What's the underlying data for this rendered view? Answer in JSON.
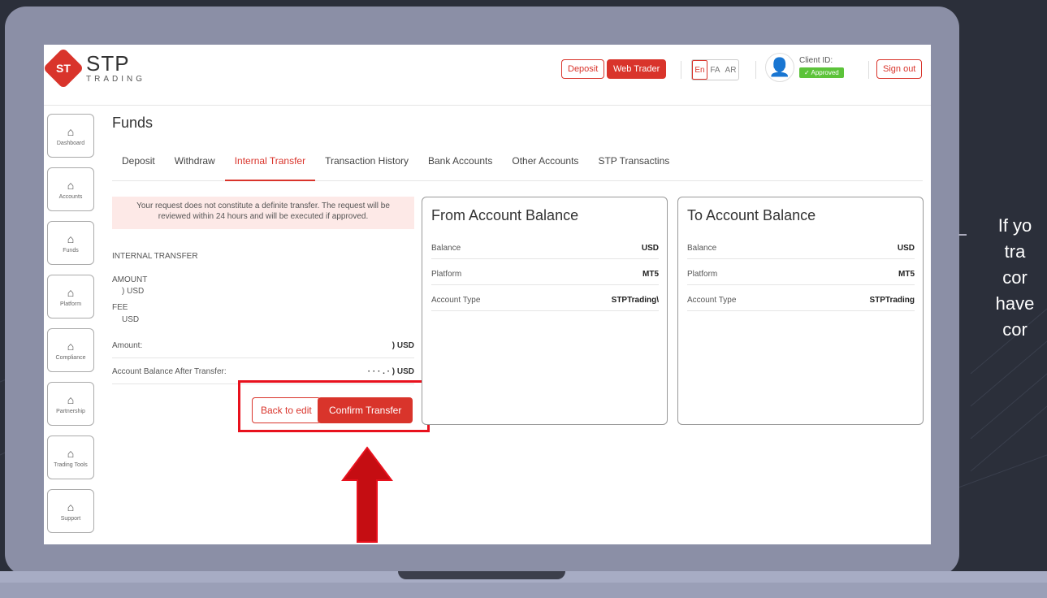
{
  "brand": {
    "mark": "ST",
    "name": "STP",
    "sub": "TRADING"
  },
  "header": {
    "deposit_label": "Deposit",
    "web_trader_label": "Web Trader",
    "languages": [
      "En",
      "FA",
      "AR"
    ],
    "client_id_label": "Client ID:",
    "status_label": "Approved",
    "sign_out_label": "Sign out"
  },
  "sidebar": {
    "items": [
      {
        "label": "Dashboard"
      },
      {
        "label": "Accounts"
      },
      {
        "label": "Funds"
      },
      {
        "label": "Platform"
      },
      {
        "label": "Compliance"
      },
      {
        "label": "Partnership"
      },
      {
        "label": "Trading Tools"
      },
      {
        "label": "Support"
      }
    ]
  },
  "page": {
    "title": "Funds"
  },
  "tabs": [
    {
      "label": "Deposit"
    },
    {
      "label": "Withdraw"
    },
    {
      "label": "Internal Transfer",
      "active": true
    },
    {
      "label": "Transaction History"
    },
    {
      "label": "Bank Accounts"
    },
    {
      "label": "Other Accounts"
    },
    {
      "label": "STP Transactins"
    }
  ],
  "transfer": {
    "notice": "Your request does not constitute a definite transfer. The request will be reviewed within 24 hours and will be executed if approved.",
    "section_title": "INTERNAL TRANSFER",
    "amount_label": "AMOUNT",
    "amount_value": ") USD",
    "fee_label": "FEE",
    "fee_value": "USD",
    "amount_row_label": "Amount:",
    "amount_row_value": ") USD",
    "balance_after_label": "Account Balance After Transfer:",
    "balance_after_value": "· · · . · ) USD",
    "back_label": "Back to edit",
    "confirm_label": "Confirm Transfer"
  },
  "from_card": {
    "title": "From Account Balance",
    "rows": [
      {
        "label": "Balance",
        "value": "USD"
      },
      {
        "label": "Platform",
        "value": "MT5"
      },
      {
        "label": "Account Type",
        "value": "STPTrading\\"
      }
    ]
  },
  "to_card": {
    "title": "To Account Balance",
    "rows": [
      {
        "label": "Balance",
        "value": "USD"
      },
      {
        "label": "Platform",
        "value": "MT5"
      },
      {
        "label": "Account Type",
        "value": "STPTrading"
      }
    ]
  },
  "side_caption": {
    "lines": [
      "If yo",
      "tra",
      "cor",
      "have",
      "cor"
    ]
  },
  "colors": {
    "accent": "#d9342b",
    "highlight": "#e8111d",
    "approved": "#5cc33a"
  }
}
